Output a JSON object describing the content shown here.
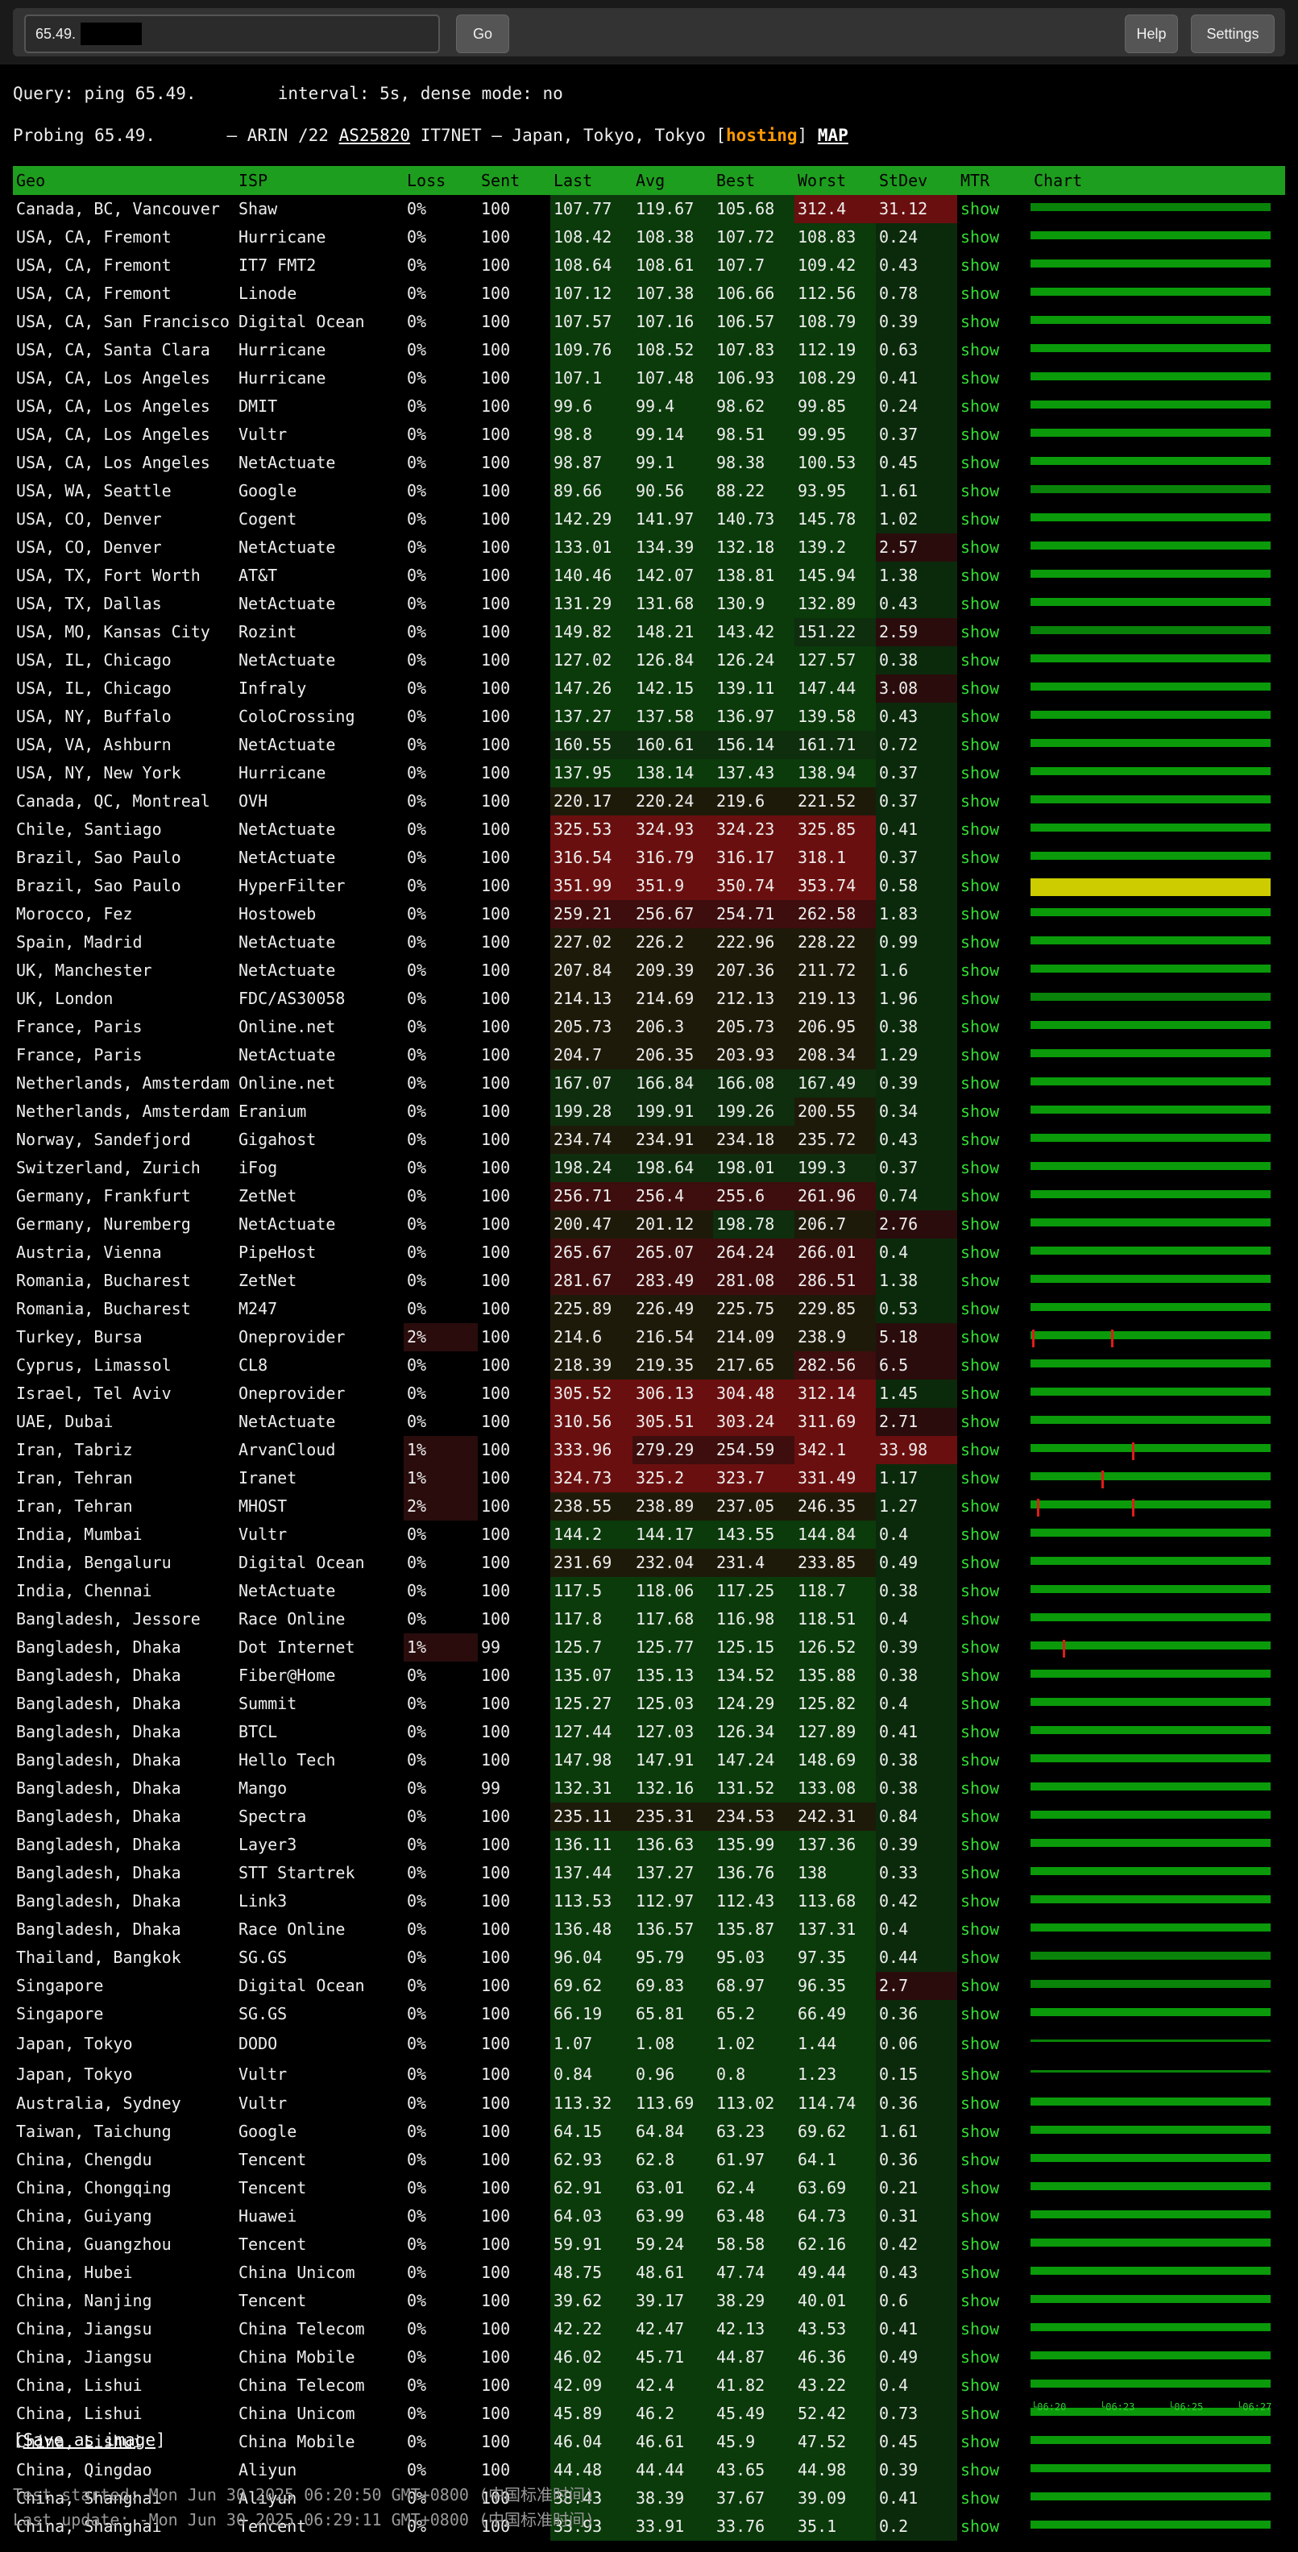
{
  "toolbar": {
    "query_value": "65.49.",
    "go_label": "Go",
    "help_label": "Help",
    "settings_label": "Settings"
  },
  "query_line": "Query: ping 65.49.        interval: 5s, dense mode: no",
  "probe": {
    "prefix": "Probing 65.49.       — ARIN /22 ",
    "asn": "AS25820",
    "mid": " IT7NET — Japan, Tokyo, Tokyo [",
    "tag": "hosting",
    "close": "] ",
    "map": "MAP"
  },
  "columns": [
    "Geo",
    "ISP",
    "Loss",
    "Sent",
    "Last",
    "Avg",
    "Best",
    "Worst",
    "StDev",
    "MTR",
    "Chart"
  ],
  "mtr_label": "show",
  "rows": [
    [
      "Canada, BC, Vancouver",
      "Shaw",
      "0%",
      "100",
      "107.77",
      "119.67",
      "105.68",
      "312.4",
      "31.12"
    ],
    [
      "USA, CA, Fremont",
      "Hurricane",
      "0%",
      "100",
      "108.42",
      "108.38",
      "107.72",
      "108.83",
      "0.24"
    ],
    [
      "USA, CA, Fremont",
      "IT7 FMT2",
      "0%",
      "100",
      "108.64",
      "108.61",
      "107.7",
      "109.42",
      "0.43"
    ],
    [
      "USA, CA, Fremont",
      "Linode",
      "0%",
      "100",
      "107.12",
      "107.38",
      "106.66",
      "112.56",
      "0.78"
    ],
    [
      "USA, CA, San Francisco",
      "Digital Ocean",
      "0%",
      "100",
      "107.57",
      "107.16",
      "106.57",
      "108.79",
      "0.39"
    ],
    [
      "USA, CA, Santa Clara",
      "Hurricane",
      "0%",
      "100",
      "109.76",
      "108.52",
      "107.83",
      "112.19",
      "0.63"
    ],
    [
      "USA, CA, Los Angeles",
      "Hurricane",
      "0%",
      "100",
      "107.1",
      "107.48",
      "106.93",
      "108.29",
      "0.41"
    ],
    [
      "USA, CA, Los Angeles",
      "DMIT",
      "0%",
      "100",
      "99.6",
      "99.4",
      "98.62",
      "99.85",
      "0.24"
    ],
    [
      "USA, CA, Los Angeles",
      "Vultr",
      "0%",
      "100",
      "98.8",
      "99.14",
      "98.51",
      "99.95",
      "0.37"
    ],
    [
      "USA, CA, Los Angeles",
      "NetActuate",
      "0%",
      "100",
      "98.87",
      "99.1",
      "98.38",
      "100.53",
      "0.45"
    ],
    [
      "USA, WA, Seattle",
      "Google",
      "0%",
      "100",
      "89.66",
      "90.56",
      "88.22",
      "93.95",
      "1.61"
    ],
    [
      "USA, CO, Denver",
      "Cogent",
      "0%",
      "100",
      "142.29",
      "141.97",
      "140.73",
      "145.78",
      "1.02"
    ],
    [
      "USA, CO, Denver",
      "NetActuate",
      "0%",
      "100",
      "133.01",
      "134.39",
      "132.18",
      "139.2",
      "2.57"
    ],
    [
      "USA, TX, Fort Worth",
      "AT&T",
      "0%",
      "100",
      "140.46",
      "142.07",
      "138.81",
      "145.94",
      "1.38"
    ],
    [
      "USA, TX, Dallas",
      "NetActuate",
      "0%",
      "100",
      "131.29",
      "131.68",
      "130.9",
      "132.89",
      "0.43"
    ],
    [
      "USA, MO, Kansas City",
      "Rozint",
      "0%",
      "100",
      "149.82",
      "148.21",
      "143.42",
      "151.22",
      "2.59"
    ],
    [
      "USA, IL, Chicago",
      "NetActuate",
      "0%",
      "100",
      "127.02",
      "126.84",
      "126.24",
      "127.57",
      "0.38"
    ],
    [
      "USA, IL, Chicago",
      "Infraly",
      "0%",
      "100",
      "147.26",
      "142.15",
      "139.11",
      "147.44",
      "3.08"
    ],
    [
      "USA, NY, Buffalo",
      "ColoCrossing",
      "0%",
      "100",
      "137.27",
      "137.58",
      "136.97",
      "139.58",
      "0.43"
    ],
    [
      "USA, VA, Ashburn",
      "NetActuate",
      "0%",
      "100",
      "160.55",
      "160.61",
      "156.14",
      "161.71",
      "0.72"
    ],
    [
      "USA, NY, New York",
      "Hurricane",
      "0%",
      "100",
      "137.95",
      "138.14",
      "137.43",
      "138.94",
      "0.37"
    ],
    [
      "Canada, QC, Montreal",
      "OVH",
      "0%",
      "100",
      "220.17",
      "220.24",
      "219.6",
      "221.52",
      "0.37"
    ],
    [
      "Chile, Santiago",
      "NetActuate",
      "0%",
      "100",
      "325.53",
      "324.93",
      "324.23",
      "325.85",
      "0.41"
    ],
    [
      "Brazil, Sao Paulo",
      "NetActuate",
      "0%",
      "100",
      "316.54",
      "316.79",
      "316.17",
      "318.1",
      "0.37"
    ],
    [
      "Brazil, Sao Paulo",
      "HyperFilter",
      "0%",
      "100",
      "351.99",
      "351.9",
      "350.74",
      "353.74",
      "0.58"
    ],
    [
      "Morocco, Fez",
      "Hostoweb",
      "0%",
      "100",
      "259.21",
      "256.67",
      "254.71",
      "262.58",
      "1.83"
    ],
    [
      "Spain, Madrid",
      "NetActuate",
      "0%",
      "100",
      "227.02",
      "226.2",
      "222.96",
      "228.22",
      "0.99"
    ],
    [
      "UK, Manchester",
      "NetActuate",
      "0%",
      "100",
      "207.84",
      "209.39",
      "207.36",
      "211.72",
      "1.6"
    ],
    [
      "UK, London",
      "FDC/AS30058",
      "0%",
      "100",
      "214.13",
      "214.69",
      "212.13",
      "219.13",
      "1.96"
    ],
    [
      "France, Paris",
      "Online.net",
      "0%",
      "100",
      "205.73",
      "206.3",
      "205.73",
      "206.95",
      "0.38"
    ],
    [
      "France, Paris",
      "NetActuate",
      "0%",
      "100",
      "204.7",
      "206.35",
      "203.93",
      "208.34",
      "1.29"
    ],
    [
      "Netherlands, Amsterdam",
      "Online.net",
      "0%",
      "100",
      "167.07",
      "166.84",
      "166.08",
      "167.49",
      "0.39"
    ],
    [
      "Netherlands, Amsterdam",
      "Eranium",
      "0%",
      "100",
      "199.28",
      "199.91",
      "199.26",
      "200.55",
      "0.34"
    ],
    [
      "Norway, Sandefjord",
      "Gigahost",
      "0%",
      "100",
      "234.74",
      "234.91",
      "234.18",
      "235.72",
      "0.43"
    ],
    [
      "Switzerland, Zurich",
      "iFog",
      "0%",
      "100",
      "198.24",
      "198.64",
      "198.01",
      "199.3",
      "0.37"
    ],
    [
      "Germany, Frankfurt",
      "ZetNet",
      "0%",
      "100",
      "256.71",
      "256.4",
      "255.6",
      "261.96",
      "0.74"
    ],
    [
      "Germany, Nuremberg",
      "NetActuate",
      "0%",
      "100",
      "200.47",
      "201.12",
      "198.78",
      "206.7",
      "2.76"
    ],
    [
      "Austria, Vienna",
      "PipeHost",
      "0%",
      "100",
      "265.67",
      "265.07",
      "264.24",
      "266.01",
      "0.4"
    ],
    [
      "Romania, Bucharest",
      "ZetNet",
      "0%",
      "100",
      "281.67",
      "283.49",
      "281.08",
      "286.51",
      "1.38"
    ],
    [
      "Romania, Bucharest",
      "M247",
      "0%",
      "100",
      "225.89",
      "226.49",
      "225.75",
      "229.85",
      "0.53"
    ],
    [
      "Turkey, Bursa",
      "Oneprovider",
      "2%",
      "100",
      "214.6",
      "216.54",
      "214.09",
      "238.9",
      "5.18"
    ],
    [
      "Cyprus, Limassol",
      "CL8",
      "0%",
      "100",
      "218.39",
      "219.35",
      "217.65",
      "282.56",
      "6.5"
    ],
    [
      "Israel, Tel Aviv",
      "Oneprovider",
      "0%",
      "100",
      "305.52",
      "306.13",
      "304.48",
      "312.14",
      "1.45"
    ],
    [
      "UAE, Dubai",
      "NetActuate",
      "0%",
      "100",
      "310.56",
      "305.51",
      "303.24",
      "311.69",
      "2.71"
    ],
    [
      "Iran, Tabriz",
      "ArvanCloud",
      "1%",
      "100",
      "333.96",
      "279.29",
      "254.59",
      "342.1",
      "33.98"
    ],
    [
      "Iran, Tehran",
      "Iranet",
      "1%",
      "100",
      "324.73",
      "325.2",
      "323.7",
      "331.49",
      "1.17"
    ],
    [
      "Iran, Tehran",
      "MHOST",
      "2%",
      "100",
      "238.55",
      "238.89",
      "237.05",
      "246.35",
      "1.27"
    ],
    [
      "India, Mumbai",
      "Vultr",
      "0%",
      "100",
      "144.2",
      "144.17",
      "143.55",
      "144.84",
      "0.4"
    ],
    [
      "India, Bengaluru",
      "Digital Ocean",
      "0%",
      "100",
      "231.69",
      "232.04",
      "231.4",
      "233.85",
      "0.49"
    ],
    [
      "India, Chennai",
      "NetActuate",
      "0%",
      "100",
      "117.5",
      "118.06",
      "117.25",
      "118.7",
      "0.38"
    ],
    [
      "Bangladesh, Jessore",
      "Race Online",
      "0%",
      "100",
      "117.8",
      "117.68",
      "116.98",
      "118.51",
      "0.4"
    ],
    [
      "Bangladesh, Dhaka",
      "Dot Internet",
      "1%",
      "99",
      "125.7",
      "125.77",
      "125.15",
      "126.52",
      "0.39"
    ],
    [
      "Bangladesh, Dhaka",
      "Fiber@Home",
      "0%",
      "100",
      "135.07",
      "135.13",
      "134.52",
      "135.88",
      "0.38"
    ],
    [
      "Bangladesh, Dhaka",
      "Summit",
      "0%",
      "100",
      "125.27",
      "125.03",
      "124.29",
      "125.82",
      "0.4"
    ],
    [
      "Bangladesh, Dhaka",
      "BTCL",
      "0%",
      "100",
      "127.44",
      "127.03",
      "126.34",
      "127.89",
      "0.41"
    ],
    [
      "Bangladesh, Dhaka",
      "Hello Tech",
      "0%",
      "100",
      "147.98",
      "147.91",
      "147.24",
      "148.69",
      "0.38"
    ],
    [
      "Bangladesh, Dhaka",
      "Mango",
      "0%",
      "99",
      "132.31",
      "132.16",
      "131.52",
      "133.08",
      "0.38"
    ],
    [
      "Bangladesh, Dhaka",
      "Spectra",
      "0%",
      "100",
      "235.11",
      "235.31",
      "234.53",
      "242.31",
      "0.84"
    ],
    [
      "Bangladesh, Dhaka",
      "Layer3",
      "0%",
      "100",
      "136.11",
      "136.63",
      "135.99",
      "137.36",
      "0.39"
    ],
    [
      "Bangladesh, Dhaka",
      "STT Startrek",
      "0%",
      "100",
      "137.44",
      "137.27",
      "136.76",
      "138",
      "0.33"
    ],
    [
      "Bangladesh, Dhaka",
      "Link3",
      "0%",
      "100",
      "113.53",
      "112.97",
      "112.43",
      "113.68",
      "0.42"
    ],
    [
      "Bangladesh, Dhaka",
      "Race Online",
      "0%",
      "100",
      "136.48",
      "136.57",
      "135.87",
      "137.31",
      "0.4"
    ],
    [
      "Thailand, Bangkok",
      "SG.GS",
      "0%",
      "100",
      "96.04",
      "95.79",
      "95.03",
      "97.35",
      "0.44"
    ],
    [
      "Singapore",
      "Digital Ocean",
      "0%",
      "100",
      "69.62",
      "69.83",
      "68.97",
      "96.35",
      "2.7"
    ],
    [
      "Singapore",
      "SG.GS",
      "0%",
      "100",
      "66.19",
      "65.81",
      "65.2",
      "66.49",
      "0.36"
    ],
    [
      "Japan, Tokyo",
      "DODO",
      "0%",
      "100",
      "1.07",
      "1.08",
      "1.02",
      "1.44",
      "0.06"
    ],
    [
      "Japan, Tokyo",
      "Vultr",
      "0%",
      "100",
      "0.84",
      "0.96",
      "0.8",
      "1.23",
      "0.15"
    ],
    [
      "Australia, Sydney",
      "Vultr",
      "0%",
      "100",
      "113.32",
      "113.69",
      "113.02",
      "114.74",
      "0.36"
    ],
    [
      "Taiwan, Taichung",
      "Google",
      "0%",
      "100",
      "64.15",
      "64.84",
      "63.23",
      "69.62",
      "1.61"
    ],
    [
      "China, Chengdu",
      "Tencent",
      "0%",
      "100",
      "62.93",
      "62.8",
      "61.97",
      "64.1",
      "0.36"
    ],
    [
      "China, Chongqing",
      "Tencent",
      "0%",
      "100",
      "62.91",
      "63.01",
      "62.4",
      "63.69",
      "0.21"
    ],
    [
      "China, Guiyang",
      "Huawei",
      "0%",
      "100",
      "64.03",
      "63.99",
      "63.48",
      "64.73",
      "0.31"
    ],
    [
      "China, Guangzhou",
      "Tencent",
      "0%",
      "100",
      "59.91",
      "59.24",
      "58.58",
      "62.16",
      "0.42"
    ],
    [
      "China, Hubei",
      "China Unicom",
      "0%",
      "100",
      "48.75",
      "48.61",
      "47.74",
      "49.44",
      "0.43"
    ],
    [
      "China, Nanjing",
      "Tencent",
      "0%",
      "100",
      "39.62",
      "39.17",
      "38.29",
      "40.01",
      "0.6"
    ],
    [
      "China, Jiangsu",
      "China Telecom",
      "0%",
      "100",
      "42.22",
      "42.47",
      "42.13",
      "43.53",
      "0.41"
    ],
    [
      "China, Jiangsu",
      "China Mobile",
      "0%",
      "100",
      "46.02",
      "45.71",
      "44.87",
      "46.36",
      "0.49"
    ],
    [
      "China, Lishui",
      "China Telecom",
      "0%",
      "100",
      "42.09",
      "42.4",
      "41.82",
      "43.22",
      "0.4"
    ],
    [
      "China, Lishui",
      "China Unicom",
      "0%",
      "100",
      "45.89",
      "46.2",
      "45.49",
      "52.42",
      "0.73"
    ],
    [
      "China, Lishui",
      "China Mobile",
      "0%",
      "100",
      "46.04",
      "46.61",
      "45.9",
      "47.52",
      "0.45"
    ],
    [
      "China, Qingdao",
      "Aliyun",
      "0%",
      "100",
      "44.48",
      "44.44",
      "43.65",
      "44.98",
      "0.39"
    ],
    [
      "China, Shanghai",
      "Aliyun",
      "0%",
      "100",
      "38.43",
      "38.39",
      "37.67",
      "39.09",
      "0.41"
    ],
    [
      "China, Shanghai",
      "Tencent",
      "0%",
      "100",
      "33.93",
      "33.91",
      "33.76",
      "35.1",
      "0.2"
    ]
  ],
  "time_axis": [
    "06:20",
    "06:23",
    "06:25",
    "06:27"
  ],
  "save_label": "Save as image",
  "test_started": "Test started: Mon Jun 30 2025 06:20:50 GMT+0800 (中国标准时间)",
  "last_update": "Last update: -Mon Jun 30 2025 06:29:11 GMT+0800 (中国标准时间)",
  "colors": {
    "header_green": "#1e9e1e",
    "bar_green": "#0a9a0a",
    "hosting_orange": "#ff9900",
    "loss_red": "#e21b1b",
    "yellow_bar": "#cccc00"
  }
}
